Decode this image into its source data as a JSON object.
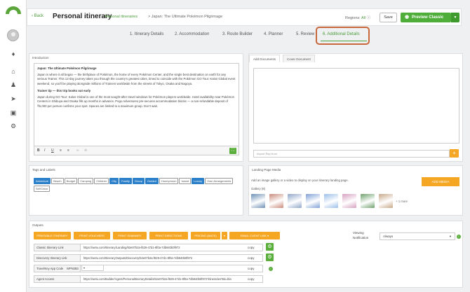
{
  "sidebar": {
    "icons": [
      "bell-icon",
      "home-icon",
      "users-icon",
      "send-icon",
      "image-icon",
      "gear-icon"
    ]
  },
  "header": {
    "back": "Back",
    "title": "Personal itinerary",
    "breadcrumb_link": "Personal itineraries",
    "breadcrumb_current": "> Japan: The Ultimate Pokémon Pilgrimage",
    "regions_label": "Regions:",
    "regions_value": "All",
    "save": "Save",
    "preview": "Preview Classic"
  },
  "tabs": [
    "1. Itinerary Details",
    "2. Accommodation",
    "3. Route Builder",
    "4. Planner",
    "5. Review",
    "6. Additional Details"
  ],
  "intro": {
    "label": "Introduction",
    "heading": "Japan: The Ultimate Pokémon Pilgrimage",
    "p1": "Japan is where it all began — the birthplace of Pokémon, the home of every Pokémon Center, and the single best destination on earth for any serious Trainer. This 12-day journey takes you through the country's greatest cities, timed to coincide with the Pokémon GO Tour: Kalos Global event weekend, so you'll be playing alongside millions of Trainers worldwide from the streets of Tokyo, Osaka and Nagoya.",
    "tip_heading": "Trainer tip — this trip books out early",
    "p2": "Japan during GO Tour: Kalos Global is one of the most sought-after travel windows for Pokémon players worldwide. Hotel availability near Pokémon Centers in Shibuya and Osaka fills up months in advance. Pogo Adventures pre-secures accommodation blocks — a non-refundable deposit of ₹5,000 per person confirms your spot. Spaces are limited to a maximum group. Don't wait."
  },
  "docs": {
    "tab1": "Add Documents",
    "tab2": "Cover Document",
    "import_placeholder": "Import Rep from"
  },
  "tags": {
    "label": "Tags and Labels",
    "items": [
      {
        "t": "Adventure",
        "on": true
      },
      {
        "t": "Beach",
        "on": false
      },
      {
        "t": "Budget",
        "on": false
      },
      {
        "t": "Camping",
        "on": false
      },
      {
        "t": "Children",
        "on": false
      },
      {
        "t": "City",
        "on": true
      },
      {
        "t": "Family",
        "on": true
      },
      {
        "t": "Group",
        "on": true
      },
      {
        "t": "Guided",
        "on": true
      },
      {
        "t": "Honeymoon",
        "on": false
      },
      {
        "t": "Island",
        "on": false
      },
      {
        "t": "Luxury",
        "on": true
      },
      {
        "t": "Own Arrangements",
        "on": false
      },
      {
        "t": "Self Drive",
        "on": false
      }
    ]
  },
  "landing": {
    "label": "Landing Page Media",
    "desc": "Add an image gallery or a video to display on your itinerary landing page.",
    "gallery": "Gallery (8)",
    "add": "ADD MEDIA",
    "more": "+ 1 more",
    "thumbs": [
      "#6b8fb5",
      "#c98a7a",
      "#8fa6c9",
      "#7fa0d6",
      "#9bbfe8",
      "#d6a0c0",
      "#6d9f6a",
      "#c8a888"
    ]
  },
  "outputs": {
    "label": "Outputs",
    "buttons": [
      "PRINTABLE ITINERARY",
      "PRINT VOUCHERS",
      "PRINT SUMMARY",
      "PRINT DIRECTIONS",
      "PRICING (BACK)",
      "EMAIL CLIENT LINK"
    ],
    "rows": [
      {
        "label": "Classic Itinerary Link",
        "value": "https://wetu.com/Itinerary/Landing/52e07b2a-f829-47d1-8f0a-7db940b0f972",
        "copy": "copy"
      },
      {
        "label": "Discovery Itinerary Link",
        "value": "https://wetu.com/ItineraryOutputs/Discovery/52e07b2a-f829-47d1-8f0a-7db940b0f972",
        "copy": "copy"
      },
      {
        "label": "TravelKey App Code",
        "value": "WPN3B3",
        "copy": "copy"
      },
      {
        "label": "Agent Access",
        "value": "https://wetu.com/Builder/Agent/PersonalItineraryDetails/52e07b2a-f829-47d1-8f0a-7db940b0f972?itinerariesTab=bla",
        "copy": "copy"
      }
    ],
    "viewing_label": "Viewing Notification",
    "viewing_value": "Always"
  }
}
